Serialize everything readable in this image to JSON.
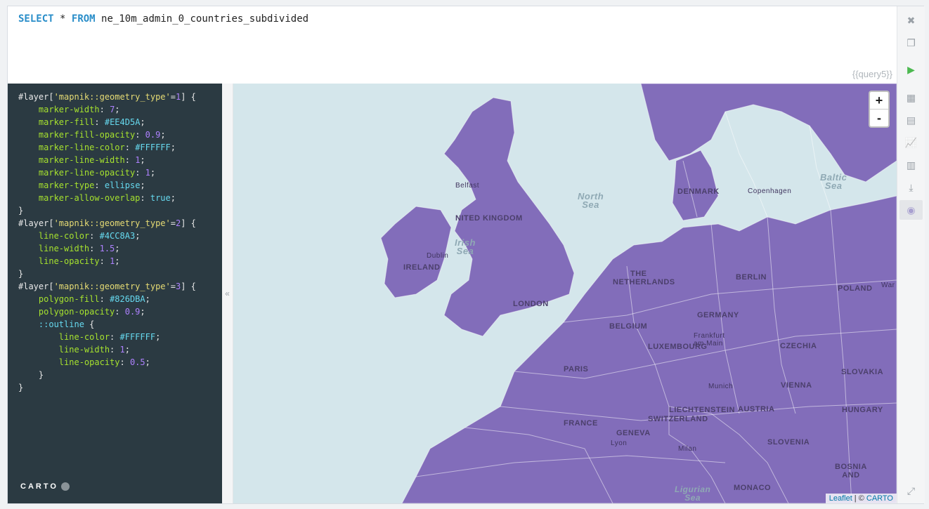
{
  "sql": {
    "kw_select": "SELECT",
    "star": "*",
    "kw_from": "FROM",
    "table": "ne_10m_admin_0_countries_subdivided"
  },
  "query_tag": "{{query5}}",
  "cartocss": [
    {
      "parts": [
        [
          "c-sel",
          "#layer["
        ],
        [
          "c-str",
          "'mapnik::geometry_type'"
        ],
        [
          "c-sel",
          "="
        ],
        [
          "c-num",
          "1"
        ],
        [
          "c-sel",
          "] {"
        ]
      ]
    },
    {
      "parts": [
        [
          "c-sel",
          "    "
        ],
        [
          "c-prop",
          "marker-width"
        ],
        [
          "c-sel",
          ": "
        ],
        [
          "c-num",
          "7"
        ],
        [
          "c-sel",
          ";"
        ]
      ]
    },
    {
      "parts": [
        [
          "c-sel",
          "    "
        ],
        [
          "c-prop",
          "marker-fill"
        ],
        [
          "c-sel",
          ": "
        ],
        [
          "c-hex",
          "#EE4D5A"
        ],
        [
          "c-sel",
          ";"
        ]
      ]
    },
    {
      "parts": [
        [
          "c-sel",
          "    "
        ],
        [
          "c-prop",
          "marker-fill-opacity"
        ],
        [
          "c-sel",
          ": "
        ],
        [
          "c-num",
          "0.9"
        ],
        [
          "c-sel",
          ";"
        ]
      ]
    },
    {
      "parts": [
        [
          "c-sel",
          "    "
        ],
        [
          "c-prop",
          "marker-line-color"
        ],
        [
          "c-sel",
          ": "
        ],
        [
          "c-hex",
          "#FFFFFF"
        ],
        [
          "c-sel",
          ";"
        ]
      ]
    },
    {
      "parts": [
        [
          "c-sel",
          "    "
        ],
        [
          "c-prop",
          "marker-line-width"
        ],
        [
          "c-sel",
          ": "
        ],
        [
          "c-num",
          "1"
        ],
        [
          "c-sel",
          ";"
        ]
      ]
    },
    {
      "parts": [
        [
          "c-sel",
          "    "
        ],
        [
          "c-prop",
          "marker-line-opacity"
        ],
        [
          "c-sel",
          ": "
        ],
        [
          "c-num",
          "1"
        ],
        [
          "c-sel",
          ";"
        ]
      ]
    },
    {
      "parts": [
        [
          "c-sel",
          "    "
        ],
        [
          "c-prop",
          "marker-type"
        ],
        [
          "c-sel",
          ": "
        ],
        [
          "c-kw",
          "ellipse"
        ],
        [
          "c-sel",
          ";"
        ]
      ]
    },
    {
      "parts": [
        [
          "c-sel",
          "    "
        ],
        [
          "c-prop",
          "marker-allow-overlap"
        ],
        [
          "c-sel",
          ": "
        ],
        [
          "c-kw",
          "true"
        ],
        [
          "c-sel",
          ";"
        ]
      ]
    },
    {
      "parts": [
        [
          "c-sel",
          "}"
        ]
      ]
    },
    {
      "parts": [
        [
          "c-sel",
          "#layer["
        ],
        [
          "c-str",
          "'mapnik::geometry_type'"
        ],
        [
          "c-sel",
          "="
        ],
        [
          "c-num",
          "2"
        ],
        [
          "c-sel",
          "] {"
        ]
      ]
    },
    {
      "parts": [
        [
          "c-sel",
          "    "
        ],
        [
          "c-prop",
          "line-color"
        ],
        [
          "c-sel",
          ": "
        ],
        [
          "c-hex",
          "#4CC8A3"
        ],
        [
          "c-sel",
          ";"
        ]
      ]
    },
    {
      "parts": [
        [
          "c-sel",
          "    "
        ],
        [
          "c-prop",
          "line-width"
        ],
        [
          "c-sel",
          ": "
        ],
        [
          "c-num",
          "1.5"
        ],
        [
          "c-sel",
          ";"
        ]
      ]
    },
    {
      "parts": [
        [
          "c-sel",
          "    "
        ],
        [
          "c-prop",
          "line-opacity"
        ],
        [
          "c-sel",
          ": "
        ],
        [
          "c-num",
          "1"
        ],
        [
          "c-sel",
          ";"
        ]
      ]
    },
    {
      "parts": [
        [
          "c-sel",
          "}"
        ]
      ]
    },
    {
      "parts": [
        [
          "c-sel",
          "#layer["
        ],
        [
          "c-str",
          "'mapnik::geometry_type'"
        ],
        [
          "c-sel",
          "="
        ],
        [
          "c-num",
          "3"
        ],
        [
          "c-sel",
          "] {"
        ]
      ]
    },
    {
      "parts": [
        [
          "c-sel",
          "    "
        ],
        [
          "c-prop",
          "polygon-fill"
        ],
        [
          "c-sel",
          ": "
        ],
        [
          "c-hex",
          "#826DBA"
        ],
        [
          "c-sel",
          ";"
        ]
      ]
    },
    {
      "parts": [
        [
          "c-sel",
          "    "
        ],
        [
          "c-prop",
          "polygon-opacity"
        ],
        [
          "c-sel",
          ": "
        ],
        [
          "c-num",
          "0.9"
        ],
        [
          "c-sel",
          ";"
        ]
      ]
    },
    {
      "parts": [
        [
          "c-sel",
          "    "
        ],
        [
          "c-kw",
          "::outline"
        ],
        [
          "c-sel",
          " {"
        ]
      ]
    },
    {
      "parts": [
        [
          "c-sel",
          "        "
        ],
        [
          "c-prop",
          "line-color"
        ],
        [
          "c-sel",
          ": "
        ],
        [
          "c-hex",
          "#FFFFFF"
        ],
        [
          "c-sel",
          ";"
        ]
      ]
    },
    {
      "parts": [
        [
          "c-sel",
          "        "
        ],
        [
          "c-prop",
          "line-width"
        ],
        [
          "c-sel",
          ": "
        ],
        [
          "c-num",
          "1"
        ],
        [
          "c-sel",
          ";"
        ]
      ]
    },
    {
      "parts": [
        [
          "c-sel",
          "        "
        ],
        [
          "c-prop",
          "line-opacity"
        ],
        [
          "c-sel",
          ": "
        ],
        [
          "c-num",
          "0.5"
        ],
        [
          "c-sel",
          ";"
        ]
      ]
    },
    {
      "parts": [
        [
          "c-sel",
          "    }"
        ]
      ]
    },
    {
      "parts": [
        [
          "c-sel",
          "}"
        ]
      ]
    }
  ],
  "carto_logo": "CARTO",
  "collapse_icon": "«",
  "toolbar": [
    {
      "name": "close-icon",
      "glyph": "✖"
    },
    {
      "name": "copy-icon",
      "glyph": "❐"
    },
    {
      "name": "run-icon",
      "glyph": "▶"
    },
    {
      "name": "table-icon",
      "glyph": "▦"
    },
    {
      "name": "card-icon",
      "glyph": "▤"
    },
    {
      "name": "line-chart-icon",
      "glyph": "📈"
    },
    {
      "name": "bar-chart-icon",
      "glyph": "▥"
    },
    {
      "name": "download-icon",
      "glyph": "⤓"
    },
    {
      "name": "map-icon",
      "glyph": "◉"
    }
  ],
  "expand_icon": "⤢",
  "zoom": {
    "in": "+",
    "out": "-"
  },
  "map_labels": {
    "united_kingdom": "NITED KINGDOM",
    "north_sea_1": "North",
    "north_sea_2": "Sea",
    "irish_sea_1": "Irish",
    "irish_sea_2": "Sea",
    "baltic_1": "Baltic",
    "baltic_2": "Sea",
    "denmark": "DENMARK",
    "copenhagen": "Copenhagen",
    "the": "THE",
    "netherlands": "NETHERLANDS",
    "berlin": "BERLIN",
    "poland": "POLAND",
    "london": "LONDON",
    "germany": "GERMANY",
    "belgium": "BELGIUM",
    "frankfurt_1": "Frankfurt",
    "frankfurt_2": "am Main",
    "czechia": "CZECHIA",
    "luxembourg": "LUXEMBOURG",
    "paris": "PARIS",
    "ireland": "IRELAND",
    "dublin": "Dublin",
    "slovakia": "SLOVAKIA",
    "vienna": "VIENNA",
    "munich": "Munich",
    "austria": "AUSTRIA",
    "hungary": "HUNGARY",
    "france": "FRANCE",
    "geneva": "GENEVA",
    "liechtenstein": "LIECHTENSTEIN",
    "switzerland": "SWITZERLAND",
    "lyon": "Lyon",
    "milan": "Milan",
    "slovenia": "SLOVENIA",
    "ligurian_1": "Ligurian",
    "ligurian_2": "Sea",
    "monaco": "MONACO",
    "bosnia_1": "BOSNIA",
    "bosnia_2": "AND",
    "warsaw": "War",
    "belfast": "Belfast"
  },
  "attribution": {
    "leaflet": "Leaflet",
    "sep": " | © ",
    "carto": "CARTO"
  },
  "colors": {
    "polygon": "#826DBA",
    "water": "#d4e6eb",
    "editor_bg": "#2b3a42",
    "sql_keyword": "#2a8ec9"
  }
}
